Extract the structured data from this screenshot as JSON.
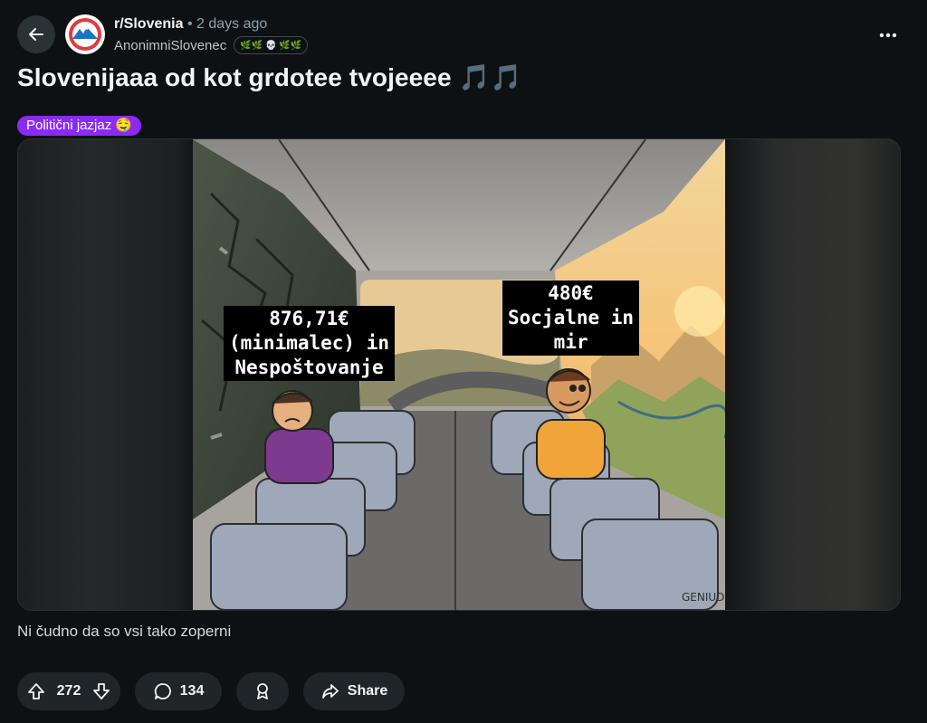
{
  "header": {
    "subreddit": "r/Slovenia",
    "separator": "•",
    "time_ago": "2 days ago",
    "author": "AnonimniSlovenec",
    "author_flair": "🌿🌿 💀 🌿🌿"
  },
  "post": {
    "title": "Slovenijaaa od kot grdotee tvojeeee",
    "title_emoji": "🎵🎵",
    "flair": "Politični jazjaz 🤤",
    "body": "Ni čudno da so vsi tako zoperni"
  },
  "meme": {
    "left_label": "876,71€\n(minimalec) in\nNespoštovanje",
    "right_label": "480€\nSocjalne in\nmir",
    "signature": "GENIUDO"
  },
  "actions": {
    "upvotes": "272",
    "comments": "134",
    "share": "Share"
  },
  "colors": {
    "background": "#0e1113",
    "pill": "#1f2528",
    "flair": "#8b2af5",
    "subreddit_icon_ring": "#e4393b",
    "subreddit_icon_blue": "#1a73c7"
  },
  "icons": [
    "back-arrow-icon",
    "more-options-icon",
    "upvote-icon",
    "downvote-icon",
    "comment-icon",
    "award-icon",
    "share-icon"
  ]
}
